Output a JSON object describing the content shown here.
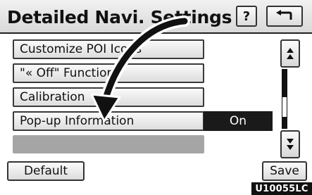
{
  "header": {
    "title": "Detailed Navi. Settings",
    "help_label": "?"
  },
  "menu": {
    "items": [
      {
        "label": "Customize POI Icons"
      },
      {
        "label": "\"« Off\" Function"
      },
      {
        "label": "Calibration"
      },
      {
        "label": "Pop-up Information",
        "value": "On"
      },
      {
        "label": ""
      }
    ]
  },
  "scrollbar": {
    "position": 0.7
  },
  "footer": {
    "default_label": "Default",
    "save_label": "Save"
  },
  "figure_code": "U10055LC",
  "icons": {
    "back": "back-arrow-icon",
    "scroll_up": "scroll-up-icon",
    "scroll_down": "scroll-down-icon",
    "callout": "callout-arrow-icon"
  }
}
